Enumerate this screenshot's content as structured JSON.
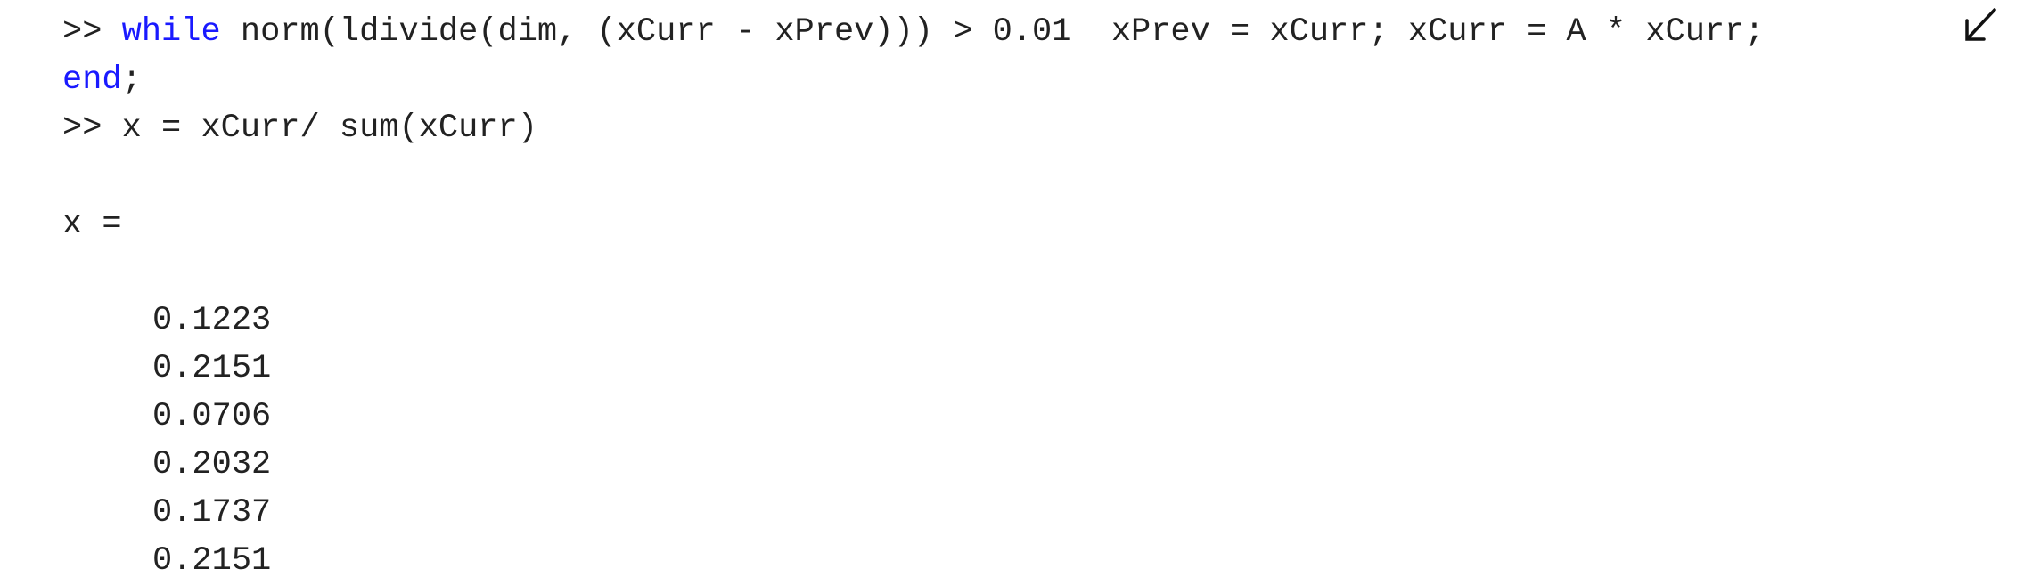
{
  "console": {
    "command1": {
      "prompt": ">> ",
      "keyword_while": "while",
      "body": " norm(ldivide(dim, (xCurr - xPrev))) > 0.01  xPrev = xCurr; xCurr = A * xCurr;",
      "continuation_icon": "arrow-down-left-icon",
      "keyword_end": "end",
      "end_suffix": ";"
    },
    "command2": {
      "prompt": ">> ",
      "text": "x = xCurr/ sum(xCurr)"
    },
    "output": {
      "variable_header": "x =",
      "values": [
        "0.1223",
        "0.2151",
        "0.0706",
        "0.2032",
        "0.1737",
        "0.2151"
      ]
    },
    "colors": {
      "keyword": "#1a1aff",
      "text": "#222222",
      "background": "#ffffff"
    }
  }
}
